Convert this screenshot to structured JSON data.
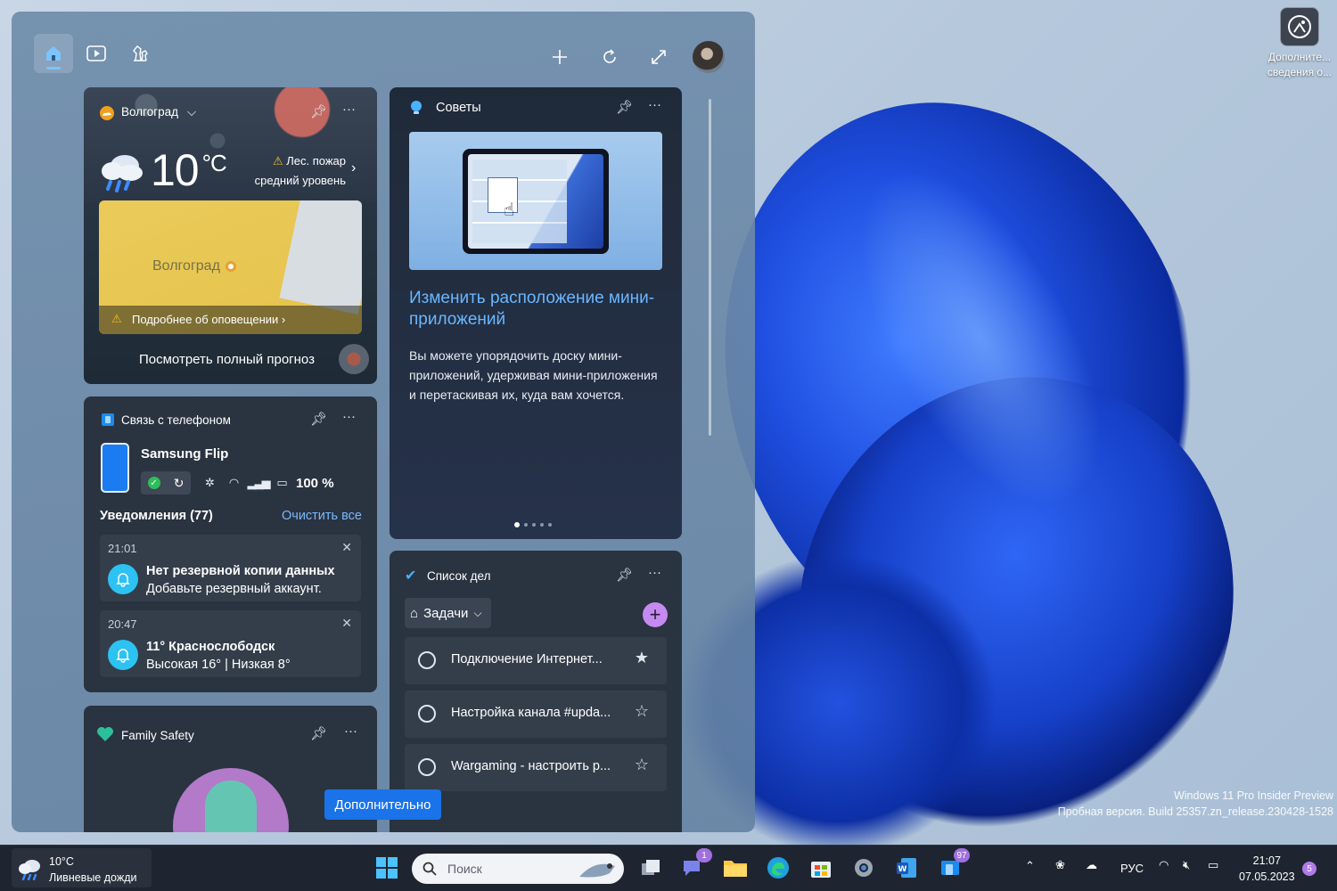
{
  "desktop": {
    "icon_label": "Дополните... сведения о...",
    "watermark_line1": "Windows 11 Pro Insider Preview",
    "watermark_line2": "Пробная версия. Build 25357.zn_release.230428-1528"
  },
  "widgets": {
    "weather": {
      "city": "Волгоград",
      "temperature": "10",
      "unit": "°C",
      "alert_title": "Лес. пожар",
      "alert_level": "средний уровень",
      "map_city": "Волгоград",
      "map_alert_link": "Подробнее об оповещении",
      "forecast_link": "Посмотреть полный прогноз"
    },
    "phone": {
      "title": "Связь с телефоном",
      "device": "Samsung Flip",
      "battery": "100 %",
      "notifications_header": "Уведомления (77)",
      "clear_all": "Очистить все",
      "notifications": [
        {
          "time": "21:01",
          "title": "Нет резервной копии данных",
          "body": "Добавьте резервный аккаунт."
        },
        {
          "time": "20:47",
          "title": "11° Краснослободск",
          "body": "Высокая 16° | Низкая 8°"
        }
      ]
    },
    "family": {
      "title": "Family Safety"
    },
    "tips": {
      "title": "Советы",
      "heading": "Изменить расположение мини-приложений",
      "body": "Вы можете упорядочить доску мини-приложений, удерживая мини-приложения и перетаскивая их, куда вам хочется."
    },
    "todo": {
      "title": "Список дел",
      "folder": "Задачи",
      "tasks": [
        {
          "text": "Подключение Интернет...",
          "starred": true
        },
        {
          "text": "Настройка канала #upda...",
          "starred": false
        },
        {
          "text": "Wargaming - настроить р...",
          "starred": false
        }
      ]
    },
    "more_button": "Дополнительно"
  },
  "taskbar": {
    "weather_temp": "10°C",
    "weather_desc": "Ливневые дожди",
    "search_placeholder": "Поиск",
    "chat_badge": "1",
    "phone_badge": "97",
    "language": "РУС",
    "time": "21:07",
    "date": "07.05.2023",
    "notification_count": "5"
  },
  "colors": {
    "accent": "#1a73e8",
    "link": "#78b9ff",
    "tips_heading": "#6bb6ff",
    "todo_add": "#c58af0"
  }
}
